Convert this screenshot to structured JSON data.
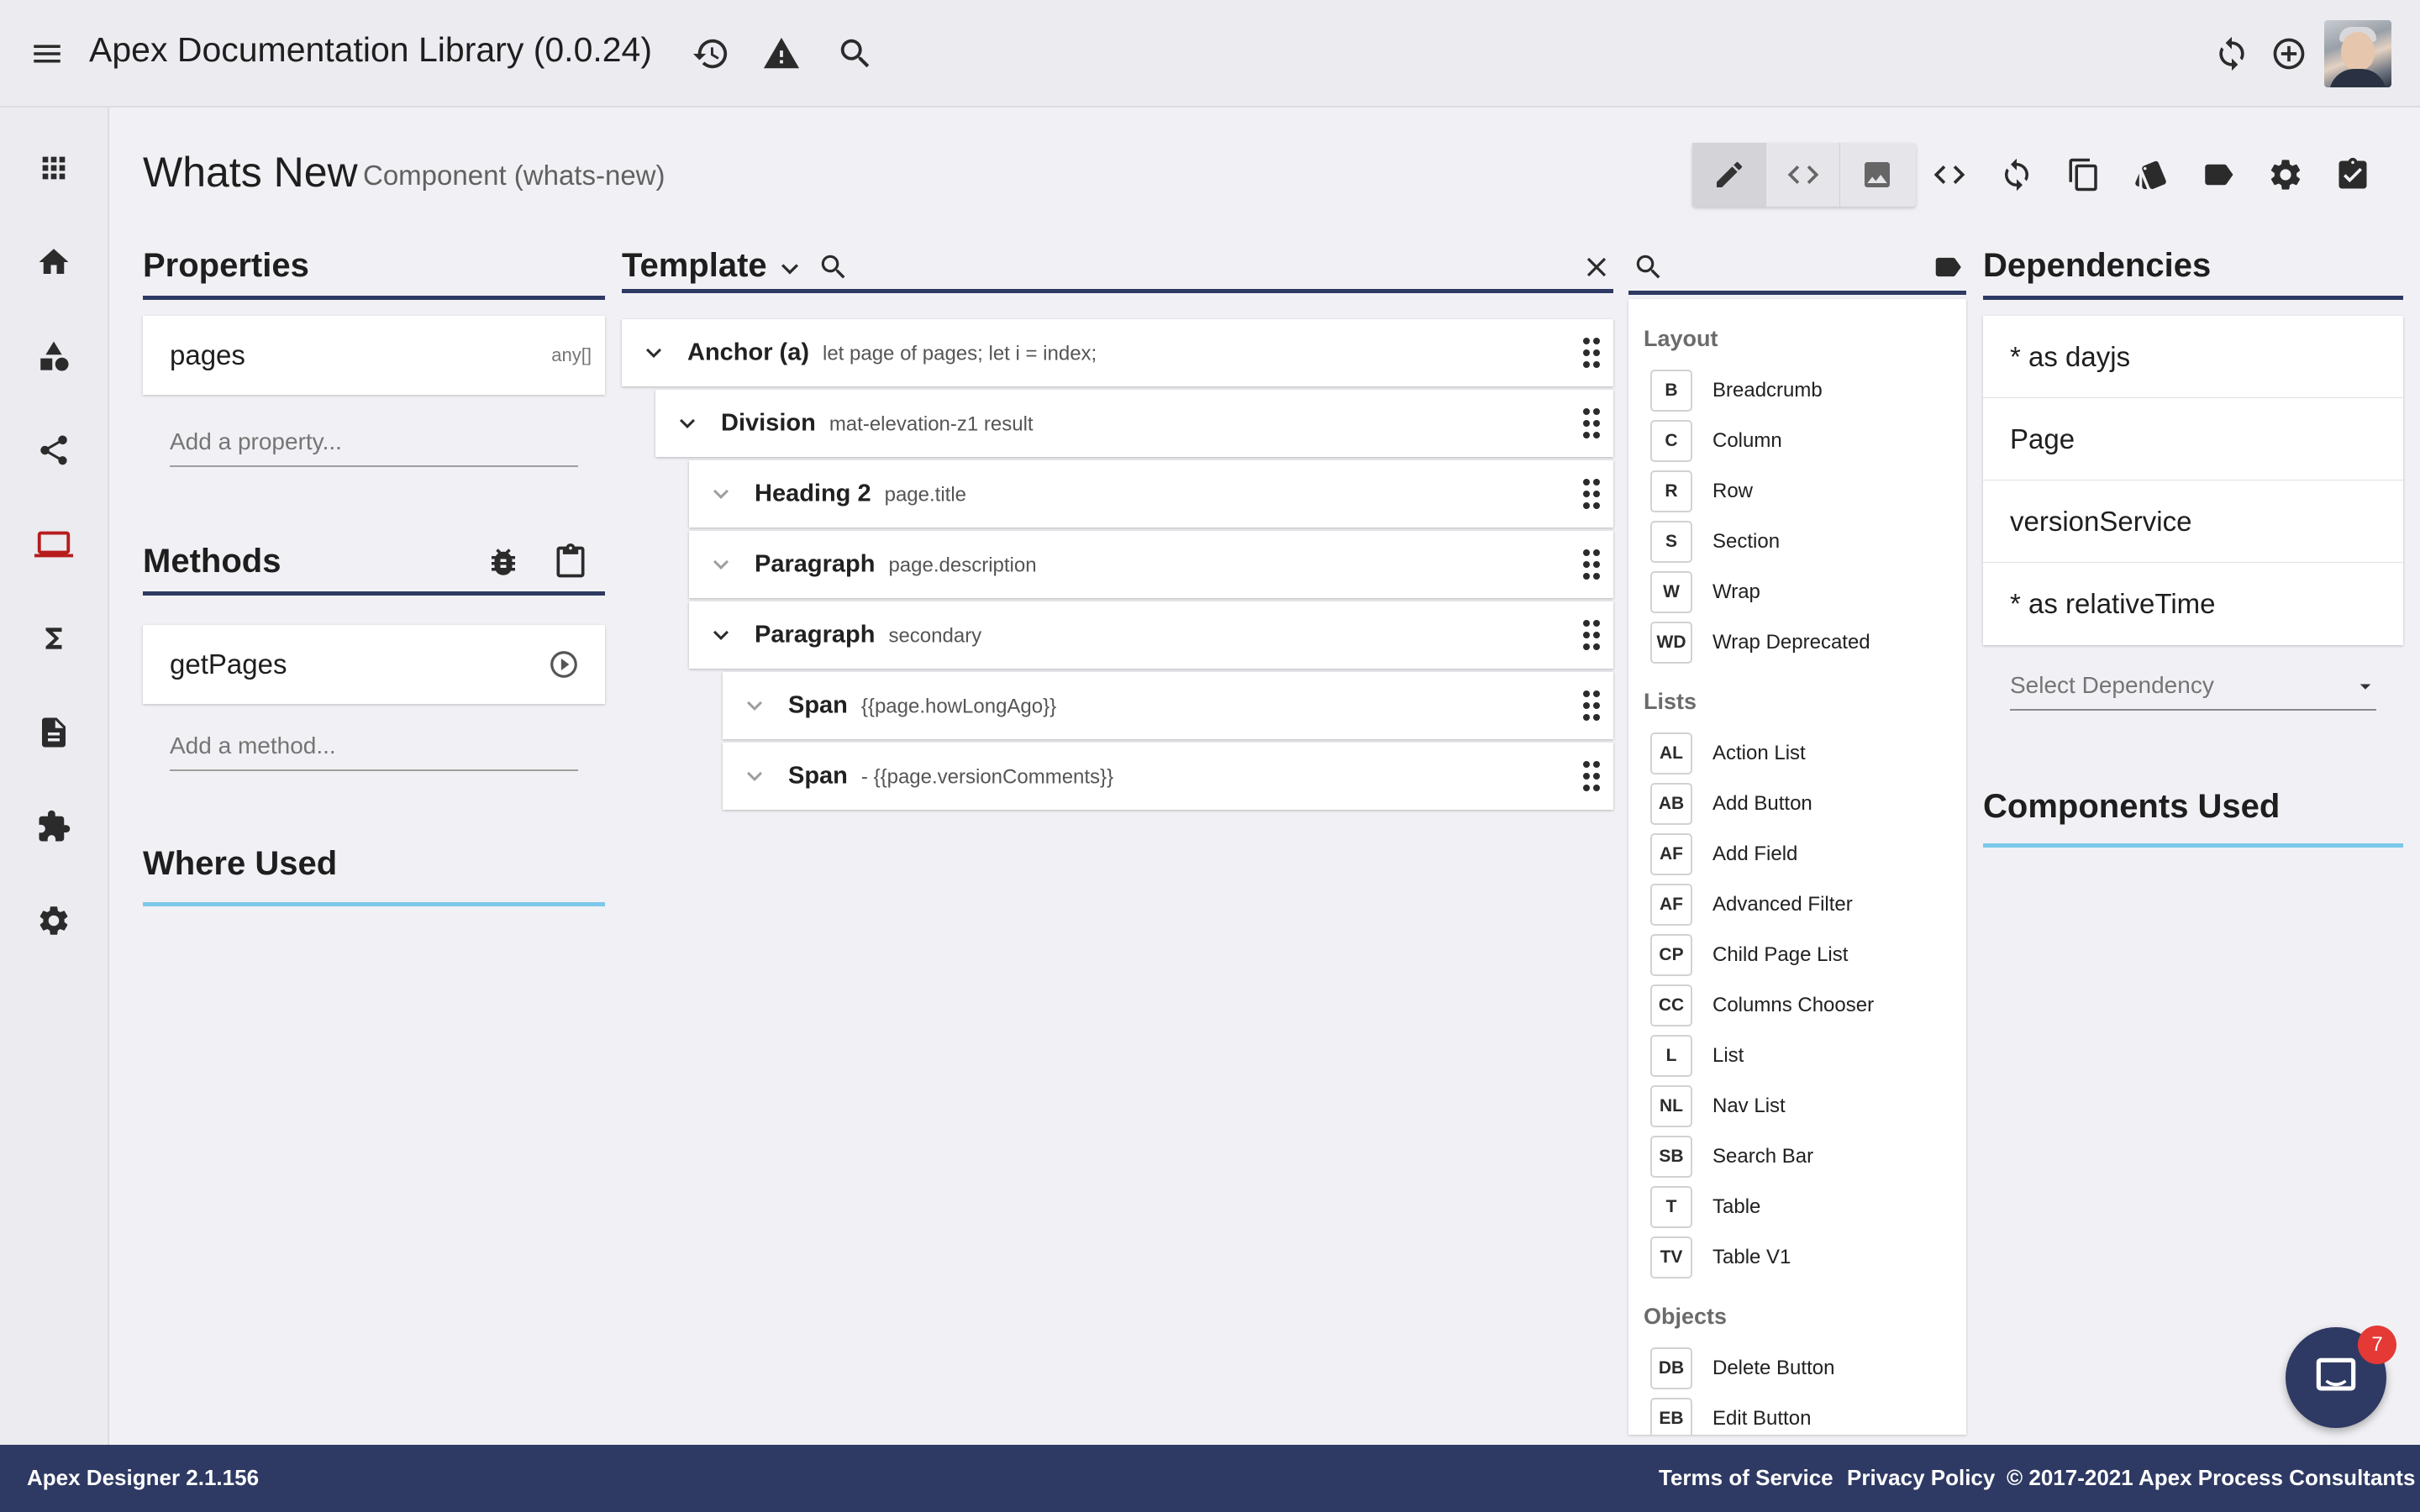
{
  "header": {
    "title": "Apex Documentation Library (0.0.24)"
  },
  "page": {
    "title": "Whats New",
    "subtitle": "Component (whats-new)"
  },
  "properties": {
    "heading": "Properties",
    "items": [
      {
        "name": "pages",
        "type": "any[]"
      }
    ],
    "add_placeholder": "Add a property..."
  },
  "methods": {
    "heading": "Methods",
    "items": [
      {
        "name": "getPages"
      }
    ],
    "add_placeholder": "Add a method..."
  },
  "where_used": {
    "heading": "Where Used"
  },
  "template": {
    "heading": "Template",
    "rows": [
      {
        "name": "Anchor (a)",
        "desc": "let page of pages; let i = index;"
      },
      {
        "name": "Division",
        "desc": "mat-elevation-z1 result"
      },
      {
        "name": "Heading 2",
        "desc": "page.title"
      },
      {
        "name": "Paragraph",
        "desc": "page.description"
      },
      {
        "name": "Paragraph",
        "desc": "secondary"
      },
      {
        "name": "Span",
        "desc": "{{page.howLongAgo}}"
      },
      {
        "name": "Span",
        "desc": "- {{page.versionComments}}"
      }
    ]
  },
  "palette": {
    "groups": [
      {
        "title": "Layout",
        "items": [
          {
            "abbr": "B",
            "label": "Breadcrumb"
          },
          {
            "abbr": "C",
            "label": "Column"
          },
          {
            "abbr": "R",
            "label": "Row"
          },
          {
            "abbr": "S",
            "label": "Section"
          },
          {
            "abbr": "W",
            "label": "Wrap"
          },
          {
            "abbr": "WD",
            "label": "Wrap Deprecated"
          }
        ]
      },
      {
        "title": "Lists",
        "items": [
          {
            "abbr": "AL",
            "label": "Action List"
          },
          {
            "abbr": "AB",
            "label": "Add Button"
          },
          {
            "abbr": "AF",
            "label": "Add Field"
          },
          {
            "abbr": "AF",
            "label": "Advanced Filter"
          },
          {
            "abbr": "CP",
            "label": "Child Page List"
          },
          {
            "abbr": "CC",
            "label": "Columns Chooser"
          },
          {
            "abbr": "L",
            "label": "List"
          },
          {
            "abbr": "NL",
            "label": "Nav List"
          },
          {
            "abbr": "SB",
            "label": "Search Bar"
          },
          {
            "abbr": "T",
            "label": "Table"
          },
          {
            "abbr": "TV",
            "label": "Table V1"
          }
        ]
      },
      {
        "title": "Objects",
        "items": [
          {
            "abbr": "DB",
            "label": "Delete Button"
          },
          {
            "abbr": "EB",
            "label": "Edit Button"
          }
        ]
      }
    ]
  },
  "dependencies": {
    "heading": "Dependencies",
    "items": [
      "* as dayjs",
      "Page",
      "versionService",
      "* as relativeTime"
    ],
    "select_placeholder": "Select Dependency"
  },
  "components_used": {
    "heading": "Components Used"
  },
  "footer": {
    "version": "Apex Designer 2.1.156",
    "terms": "Terms of Service",
    "privacy": "Privacy Policy",
    "copyright": "© 2017-2021 Apex Process Consultants"
  },
  "chat": {
    "unread": "7"
  },
  "colors": {
    "primary": "#2e3a63",
    "accent_light": "#7cc8ea",
    "nav_active": "#b71c1c",
    "background": "#f1f1f5"
  },
  "icons": {
    "header": [
      "menu-icon",
      "history-icon",
      "warning-icon",
      "search-icon",
      "refresh-icon",
      "add-circle-icon"
    ],
    "rail": [
      "apps-icon",
      "home-icon",
      "shapes-icon",
      "share-icon",
      "laptop-icon",
      "sigma-icon",
      "file-icon",
      "puzzle-icon",
      "settings-icon"
    ],
    "toolbar": [
      "edit-icon",
      "code-icon",
      "image-icon",
      "code-icon",
      "sync-icon",
      "copy-icon",
      "styles-icon",
      "label-icon",
      "settings-icon",
      "assignment-check-icon"
    ]
  }
}
